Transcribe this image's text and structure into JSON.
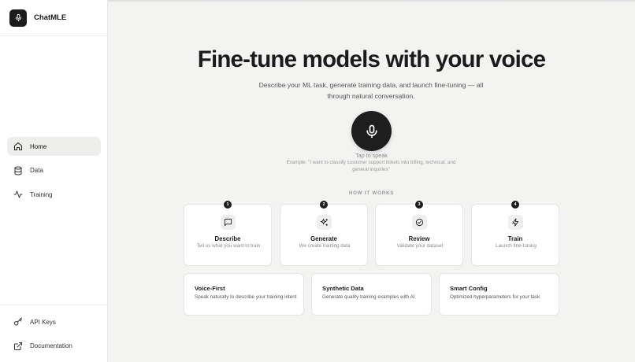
{
  "app": {
    "name": "ChatMLE",
    "logo_icon": "mic-icon"
  },
  "sidebar": {
    "nav": [
      {
        "label": "Home",
        "icon": "home-icon",
        "active": true
      },
      {
        "label": "Data",
        "icon": "database-icon",
        "active": false
      },
      {
        "label": "Training",
        "icon": "activity-icon",
        "active": false
      }
    ],
    "bottom": [
      {
        "label": "API Keys",
        "icon": "key-icon"
      },
      {
        "label": "Documentation",
        "icon": "external-link-icon"
      }
    ]
  },
  "hero": {
    "title": "Fine-tune models with your voice",
    "subtitle": "Describe your ML task, generate training data, and launch fine-tuning — all through natural conversation.",
    "mic_icon": "mic-icon",
    "tap_label": "Tap to speak",
    "example": "Example: \"I want to classify customer support tickets into billing, technical, and general inquiries\""
  },
  "how_it_works": {
    "heading": "HOW IT WORKS",
    "steps": [
      {
        "number": "1",
        "title": "Describe",
        "description": "Tell us what you want to train",
        "icon": "message-square-icon"
      },
      {
        "number": "2",
        "title": "Generate",
        "description": "We create training data",
        "icon": "sparkles-icon"
      },
      {
        "number": "3",
        "title": "Review",
        "description": "Validate your dataset",
        "icon": "check-circle-icon"
      },
      {
        "number": "4",
        "title": "Train",
        "description": "Launch fine-tuning",
        "icon": "zap-icon"
      }
    ]
  },
  "features": [
    {
      "title": "Voice-First",
      "description": "Speak naturally to describe your training intent"
    },
    {
      "title": "Synthetic Data",
      "description": "Generate quality training examples with AI"
    },
    {
      "title": "Smart Config",
      "description": "Optimized hyperparameters for your task"
    }
  ],
  "colors": {
    "accent": "#1c1c1c",
    "background": "#f3f3f2",
    "card": "#ffffff",
    "active_nav": "#eeeeec"
  }
}
